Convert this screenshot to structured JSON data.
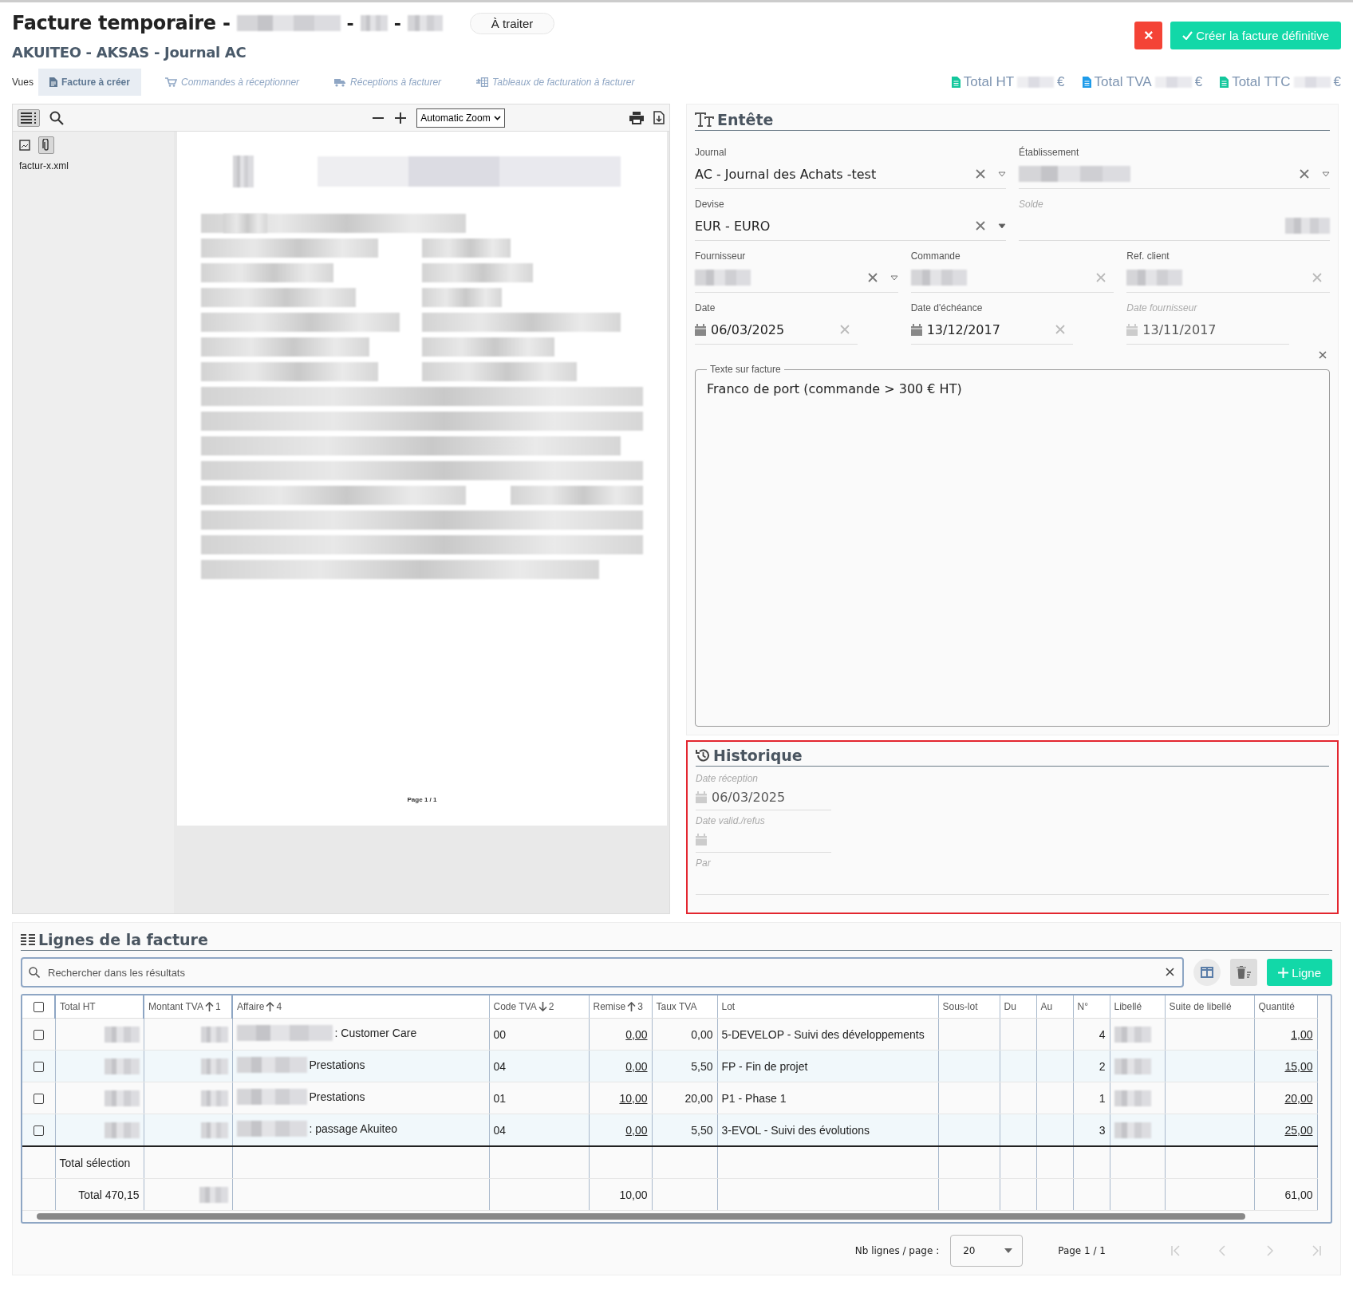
{
  "header": {
    "title": "Facture temporaire -",
    "title_separators": [
      "-",
      "-"
    ],
    "status": "À traiter",
    "subtitle": "AKUITEO - AKSAS - Journal AC",
    "cancel_label": "×",
    "create_label": "Créer la facture définitive"
  },
  "views": {
    "label": "Vues",
    "tabs": [
      {
        "label": "Facture à créer",
        "selected": true
      },
      {
        "label": "Commandes à réceptionner",
        "selected": false
      },
      {
        "label": "Réceptions à facturer",
        "selected": false
      },
      {
        "label": "Tableaux de facturation à facturer",
        "selected": false
      }
    ]
  },
  "totals": [
    {
      "label": "Total HT",
      "currency": "€"
    },
    {
      "label": "Total TVA",
      "currency": "€"
    },
    {
      "label": "Total TTC",
      "currency": "€"
    }
  ],
  "viewer": {
    "zoom": "Automatic Zoom",
    "attachment": "factur-x.xml",
    "page_label": "Page 1 / 1"
  },
  "entete": {
    "title": "Entête",
    "rows": [
      [
        {
          "label": "Journal",
          "kind": "select",
          "value": "AC - Journal des Achats -test",
          "masked": false,
          "disabled": false
        },
        {
          "label": "Établissement",
          "kind": "select",
          "masked": true,
          "disabled": false
        }
      ],
      [
        {
          "label": "Devise",
          "kind": "select",
          "value": "EUR - EURO",
          "masked": false,
          "disabled": false
        },
        {
          "label": "Solde",
          "kind": "text",
          "masked": true,
          "disabled": true
        }
      ],
      [
        {
          "label": "Fournisseur",
          "kind": "select",
          "masked": true,
          "disabled": false
        },
        {
          "label": "Commande",
          "kind": "clear",
          "masked": true,
          "disabled": false
        },
        {
          "label": "Ref. client",
          "kind": "clear",
          "masked": true,
          "disabled": false
        }
      ],
      [
        {
          "label": "Date",
          "kind": "date",
          "value": "06/03/2025",
          "masked": false,
          "disabled": false
        },
        {
          "label": "Date d'échéance",
          "kind": "date",
          "value": "13/12/2017",
          "masked": false,
          "disabled": false
        },
        {
          "label": "Date fournisseur",
          "kind": "date",
          "value": "13/11/2017",
          "masked": false,
          "disabled": true
        }
      ]
    ],
    "note": {
      "label": "Texte sur facture",
      "value": "Franco de port (commande > 300 € HT)"
    }
  },
  "historique": {
    "title": "Historique",
    "highlighted": true,
    "fields": [
      {
        "label": "Date réception",
        "kind": "date",
        "value": "06/03/2025",
        "disabled": true
      },
      {
        "label": "Date valid./refus",
        "kind": "date",
        "disabled": true
      },
      {
        "label": "Par",
        "kind": "text",
        "disabled": true
      }
    ]
  },
  "lines": {
    "title": "Lignes de la facture",
    "all_checked": false,
    "search": {
      "placeholder": "Rechercher dans les résultats"
    },
    "add_label": "Ligne",
    "columns": [
      {
        "label": "Total HT"
      },
      {
        "label": "Montant TVA",
        "descending": false,
        "order": "1"
      },
      {
        "label": "Affaire",
        "descending": false,
        "order": "4"
      },
      {
        "label": "Code TVA",
        "descending": true,
        "order": "2"
      },
      {
        "label": "Remise",
        "descending": false,
        "order": "3"
      },
      {
        "label": "Taux TVA"
      },
      {
        "label": "Lot"
      },
      {
        "label": "Sous-lot"
      },
      {
        "label": "Du"
      },
      {
        "label": "Au"
      },
      {
        "label": "N°"
      },
      {
        "label": "Libellé"
      },
      {
        "label": "Suite de libellé"
      },
      {
        "label": "Quantité"
      }
    ],
    "rows": [
      {
        "checked": false,
        "affaire": ": Customer Care",
        "code_tva": "00",
        "remise": "0,00",
        "taux_tva": "0,00",
        "lot": "5-DEVELOP - Suivi des développements",
        "no": "4",
        "quantite": "1,00"
      },
      {
        "checked": false,
        "affaire": "Prestations",
        "code_tva": "04",
        "remise": "0,00",
        "taux_tva": "5,50",
        "lot": "FP - Fin de projet",
        "no": "2",
        "quantite": "15,00"
      },
      {
        "checked": false,
        "affaire": "Prestations",
        "code_tva": "01",
        "remise": "10,00",
        "taux_tva": "20,00",
        "lot": "P1 - Phase 1",
        "no": "1",
        "quantite": "20,00"
      },
      {
        "checked": false,
        "affaire": ": passage Akuiteo",
        "code_tva": "04",
        "remise": "0,00",
        "taux_tva": "5,50",
        "lot": "3-EVOL - Suivi des évolutions",
        "no": "3",
        "quantite": "25,00"
      }
    ],
    "selection_label": "Total sélection",
    "total_label": "Total 470,15",
    "total_remise": "10,00",
    "total_quantite": "61,00"
  },
  "pagination": {
    "rows_label": "Nb lignes / page :",
    "rows_value": "20",
    "page_label": "Page 1 / 1"
  }
}
